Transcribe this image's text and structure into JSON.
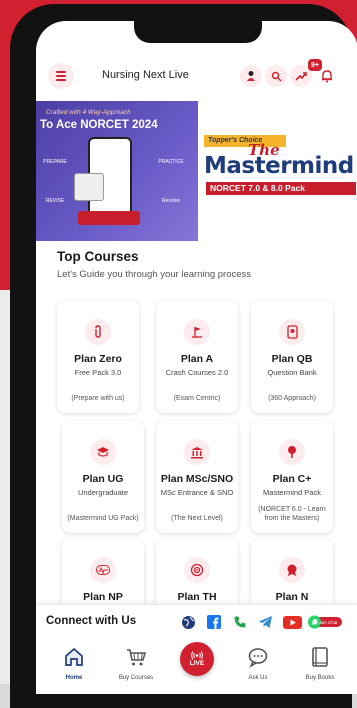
{
  "header": {
    "brand": "Nursing Next Live",
    "notification_badge": "9+"
  },
  "banner": {
    "left": {
      "tagline": "Crafted with 4 Way-Approach",
      "title": "To Ace NORCET 2024",
      "features": [
        "PREPARE",
        "PRACTICE",
        "REVISE",
        "Resolve"
      ]
    },
    "right": {
      "tag": "Topper's Choice",
      "script": "The",
      "title": "Mastermind",
      "subtitle": "NORCET 7.0 & 8.0 Pack"
    }
  },
  "courses": {
    "title": "Top Courses",
    "subtitle": "Let's Guide you through your learning process",
    "items": [
      {
        "title": "Plan Zero",
        "subtitle": "Free Pack 3.0",
        "note": "(Prepare with us)"
      },
      {
        "title": "Plan A",
        "subtitle": "Crash Courses 2.0",
        "note": "(Exam Centric)"
      },
      {
        "title": "Plan QB",
        "subtitle": "Question Bank",
        "note": "(360 Approach)"
      },
      {
        "title": "Plan UG",
        "subtitle": "Undergraduate",
        "note": "(Mastermind UG Pack)"
      },
      {
        "title": "Plan MSc/SNO",
        "subtitle": "MSc Entrance & SNO",
        "note": "(The Next Level)"
      },
      {
        "title": "Plan C+",
        "subtitle": "Mastermind Pack",
        "note": "(NORCET 6.0 - Learn from the Masters)"
      },
      {
        "title": "Plan NP",
        "subtitle": "",
        "note": ""
      },
      {
        "title": "Plan TH",
        "subtitle": "",
        "note": ""
      },
      {
        "title": "Plan N",
        "subtitle": "",
        "note": ""
      }
    ]
  },
  "connect": {
    "label": "Connect with Us",
    "whatsapp_text": "Join Chat"
  },
  "nav": {
    "items": [
      {
        "label": "Home"
      },
      {
        "label": "Buy Courses"
      },
      {
        "label": "LIVE"
      },
      {
        "label": "Ask Us"
      },
      {
        "label": "Buy Books"
      }
    ]
  },
  "colors": {
    "brand_red": "#d1202f",
    "brand_blue": "#1f3d7a",
    "banner_purple": "#5a4db8"
  }
}
